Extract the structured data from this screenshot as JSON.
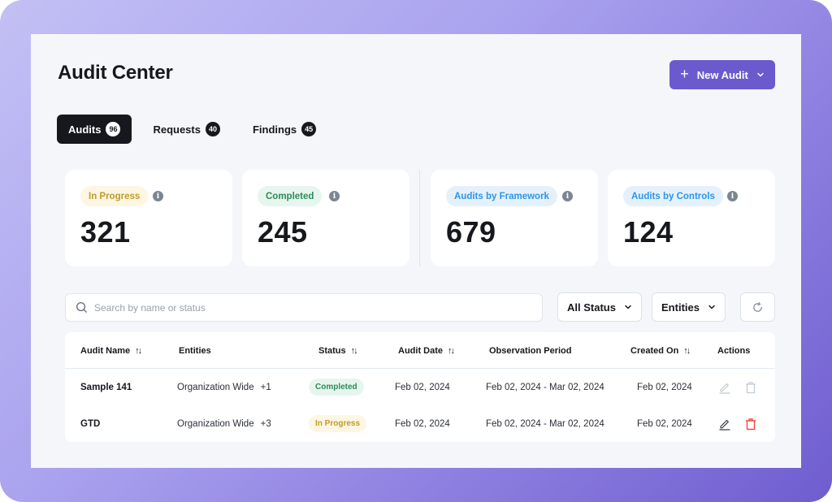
{
  "page": {
    "title": "Audit Center",
    "new_audit_label": "New Audit",
    "new_audit_icon": "plus-icon",
    "new_audit_caret": "chevron-down-icon"
  },
  "colors": {
    "accent": "#6a5acd",
    "dark": "#16181d",
    "background": "#f5f6fa",
    "danger": "#ef4b3f"
  },
  "tabs": [
    {
      "label": "Audits",
      "count": "96",
      "active": true
    },
    {
      "label": "Requests",
      "count": "40",
      "active": false
    },
    {
      "label": "Findings",
      "count": "45",
      "active": false
    }
  ],
  "stats": [
    {
      "label": "In Progress",
      "value": "321",
      "tone": "yellow",
      "icon": "info-icon"
    },
    {
      "label": "Completed",
      "value": "245",
      "tone": "green",
      "icon": "info-icon"
    },
    {
      "label": "Audits by Framework",
      "value": "679",
      "tone": "blue",
      "icon": "info-icon"
    },
    {
      "label": "Audits by Controls",
      "value": "124",
      "tone": "blue",
      "icon": "info-icon"
    }
  ],
  "filters": {
    "search_placeholder": "Search by name or status",
    "search_value": "",
    "status_dropdown": "All Status",
    "entities_dropdown": "Entities",
    "refresh_icon": "refresh-icon"
  },
  "table": {
    "columns": [
      {
        "label": "Audit Name",
        "sortable": true
      },
      {
        "label": "Entities",
        "sortable": false
      },
      {
        "label": "Status",
        "sortable": true
      },
      {
        "label": "Audit Date",
        "sortable": true
      },
      {
        "label": "Observation Period",
        "sortable": false
      },
      {
        "label": "Created On",
        "sortable": true
      },
      {
        "label": "Actions",
        "sortable": false
      }
    ],
    "sort_glyph": "↑↓",
    "rows": [
      {
        "name": "Sample 141",
        "entities": "Organization Wide",
        "entities_extra": "+1",
        "status": "Completed",
        "status_tone": "green",
        "audit_date": "Feb 02, 2024",
        "observation_period": "Feb 02, 2024 - Mar 02, 2024",
        "created_on": "Feb 02, 2024",
        "actions_enabled": false
      },
      {
        "name": "GTD",
        "entities": "Organization Wide",
        "entities_extra": "+3",
        "status": "In Progress",
        "status_tone": "yellow",
        "audit_date": "Feb 02, 2024",
        "observation_period": "Feb 02, 2024 - Mar 02, 2024",
        "created_on": "Feb 02, 2024",
        "actions_enabled": true
      }
    ]
  }
}
